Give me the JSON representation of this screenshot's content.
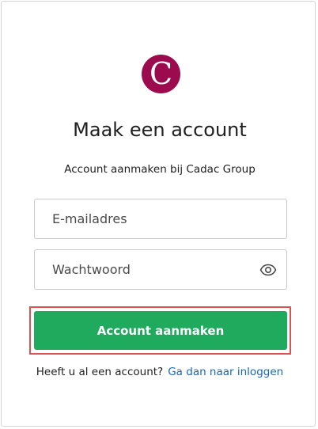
{
  "brand": {
    "logo_letter": "C",
    "logo_color": "#9b0b4e"
  },
  "header": {
    "title": "Maak een account",
    "subtitle": "Account aanmaken bij Cadac Group"
  },
  "form": {
    "email_placeholder": "E-mailadres",
    "email_value": "",
    "password_placeholder": "Wachtwoord",
    "password_value": "",
    "show_password_icon": "eye-icon",
    "submit_label": "Account aanmaken",
    "submit_color": "#1faa5e",
    "highlight_color": "#d9534f"
  },
  "footer": {
    "prompt": "Heeft u al een account?",
    "login_link": "Ga dan naar inloggen",
    "link_color": "#1565c0"
  }
}
